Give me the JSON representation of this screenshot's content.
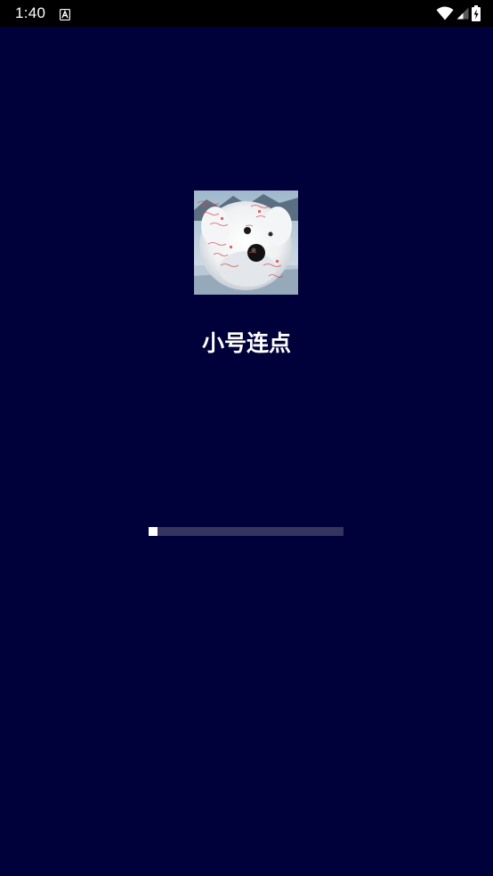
{
  "status_bar": {
    "time": "1:40",
    "notification_icon": "a-launcher-icon",
    "wifi_icon": "wifi-icon",
    "signal_icon": "cell-signal-icon",
    "battery_icon": "battery-charging-icon"
  },
  "splash": {
    "logo_icon": "white-puppy-photo-icon",
    "app_name": "小号连点",
    "progress_fraction": 0.045
  },
  "colors": {
    "background": "#00003a",
    "progress_track": "#34345e",
    "progress_fill": "#ffffff"
  }
}
